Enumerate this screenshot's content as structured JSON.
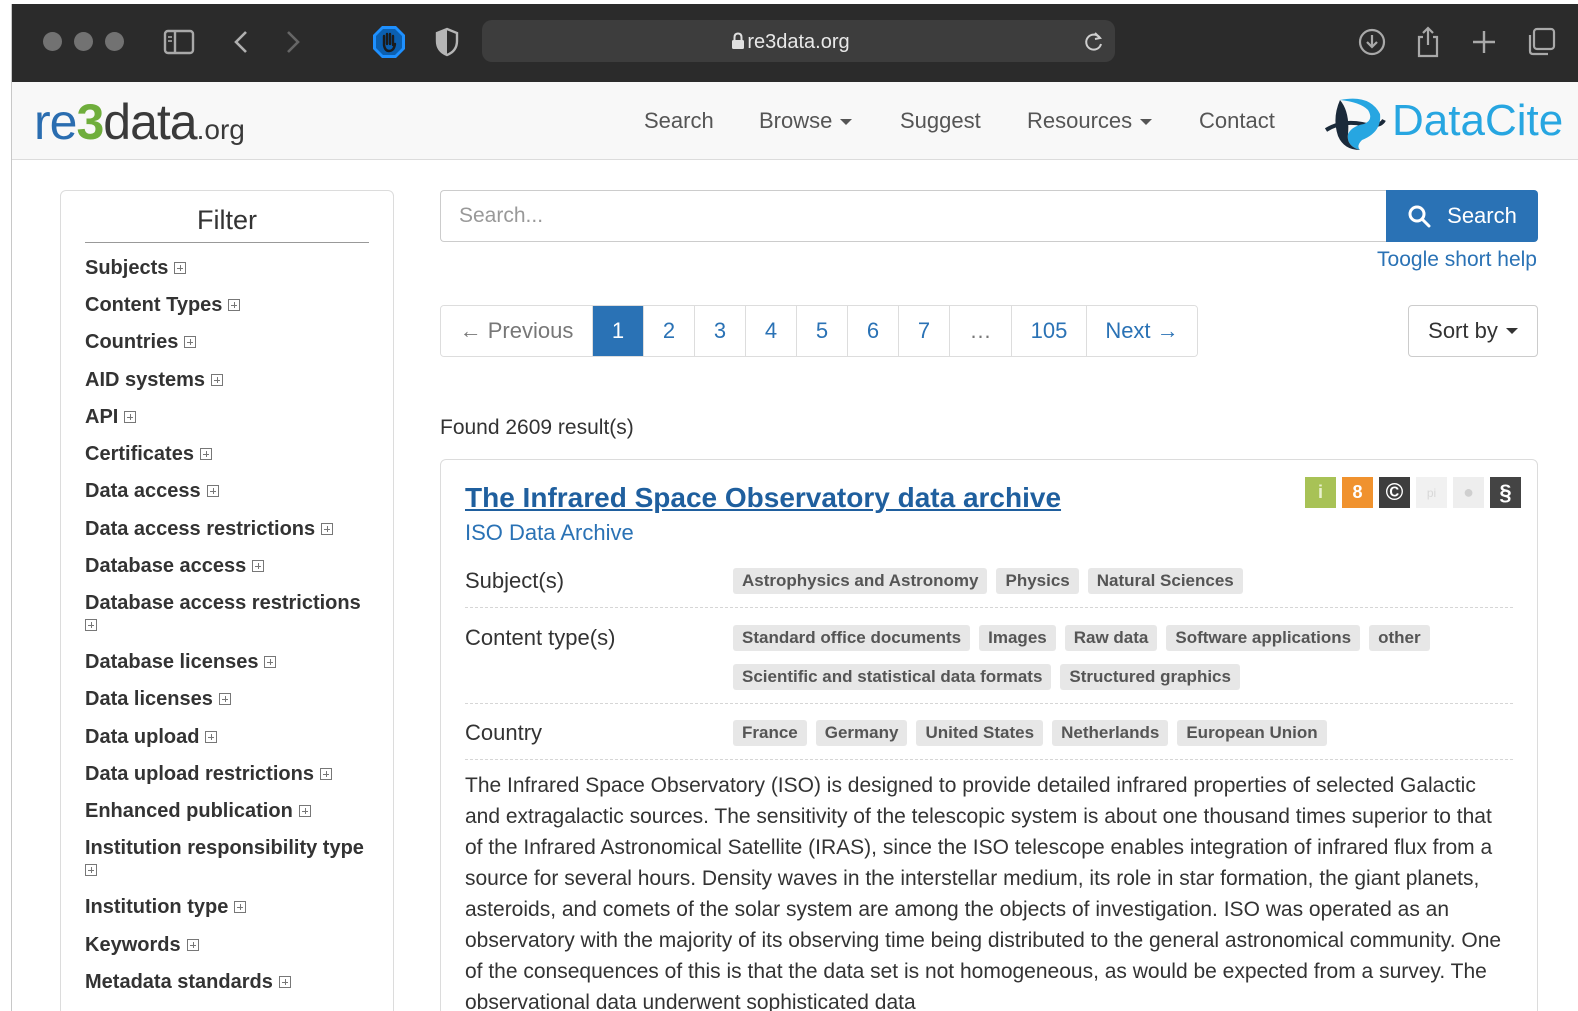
{
  "browser": {
    "url": "re3data.org",
    "icons": [
      "sidebar-icon",
      "back-icon",
      "forward-icon",
      "adblock-hand-icon",
      "privacy-shield-icon",
      "lock-icon",
      "reload-icon",
      "download-icon",
      "share-icon",
      "new-tab-icon",
      "tabs-overview-icon"
    ]
  },
  "site": {
    "logo": {
      "re": "re",
      "three": "3",
      "data": "data",
      "org": ".org"
    },
    "nav": {
      "search": "Search",
      "browse": "Browse",
      "suggest": "Suggest",
      "resources": "Resources",
      "contact": "Contact"
    },
    "partner_logo": "DataCite"
  },
  "filter": {
    "title": "Filter",
    "items": [
      "Subjects",
      "Content Types",
      "Countries",
      "AID systems",
      "API",
      "Certificates",
      "Data access",
      "Data access restrictions",
      "Database access",
      "Database access restrictions",
      "Database licenses",
      "Data licenses",
      "Data upload",
      "Data upload restrictions",
      "Enhanced publication",
      "Institution responsibility type",
      "Institution type",
      "Keywords",
      "Metadata standards"
    ]
  },
  "search": {
    "placeholder": "Search...",
    "button": "Search",
    "help": "Toogle short help"
  },
  "pagination": {
    "previous": "← Previous",
    "pages": [
      "1",
      "2",
      "3",
      "4",
      "5",
      "6",
      "7",
      "…",
      "105"
    ],
    "active_page": "1",
    "next": "Next →"
  },
  "sort": {
    "label": "Sort by"
  },
  "results": {
    "found": "Found 2609 result(s)",
    "items": [
      {
        "title": "The Infrared Space Observatory data archive",
        "subtitle": "ISO Data Archive",
        "badges": [
          {
            "name": "info-badge-icon",
            "glyph": "i",
            "bg": "#a8c256",
            "fg": "#e9f1cf"
          },
          {
            "name": "open-access-icon",
            "glyph": "8",
            "bg": "#f0922e",
            "fg": "#ffffff"
          },
          {
            "name": "copyright-icon",
            "glyph": "©",
            "bg": "#3e3e3e",
            "fg": "#ffffff"
          },
          {
            "name": "pid-icon",
            "glyph": "pi",
            "bg": "#f1f1f1",
            "fg": "#d8d8d8"
          },
          {
            "name": "certificate-icon",
            "glyph": "●",
            "bg": "#eeeeee",
            "fg": "#cfcfcf"
          },
          {
            "name": "policy-icon",
            "glyph": "§",
            "bg": "#444444",
            "fg": "#ffffff"
          }
        ],
        "subjects_label": "Subject(s)",
        "subjects": [
          "Astrophysics and Astronomy",
          "Physics",
          "Natural Sciences"
        ],
        "content_types_label": "Content type(s)",
        "content_types": [
          "Standard office documents",
          "Images",
          "Raw data",
          "Software applications",
          "other",
          "Scientific and statistical data formats",
          "Structured graphics"
        ],
        "country_label": "Country",
        "countries": [
          "France",
          "Germany",
          "United States",
          "Netherlands",
          "European Union"
        ],
        "description": "The Infrared Space Observatory (ISO) is designed to provide detailed infrared properties of selected Galactic and extragalactic sources. The sensitivity of the telescopic system is about one thousand times superior to that of the Infrared Astronomical Satellite (IRAS), since the ISO telescope enables integration of infrared flux from a source for several hours. Density waves in the interstellar medium, its role in star formation, the giant planets, asteroids, and comets of the solar system are among the objects of investigation. ISO was operated as an observatory with the majority of its observing time being distributed to the general astronomical community. One of the consequences of this is that the data set is not homogeneous, as would be expected from a survey. The observational data underwent sophisticated data"
      }
    ]
  },
  "colors": {
    "accent": "#2a72b5",
    "chrome": "#2b2b2b",
    "tag_bg": "#e7e7e7"
  }
}
